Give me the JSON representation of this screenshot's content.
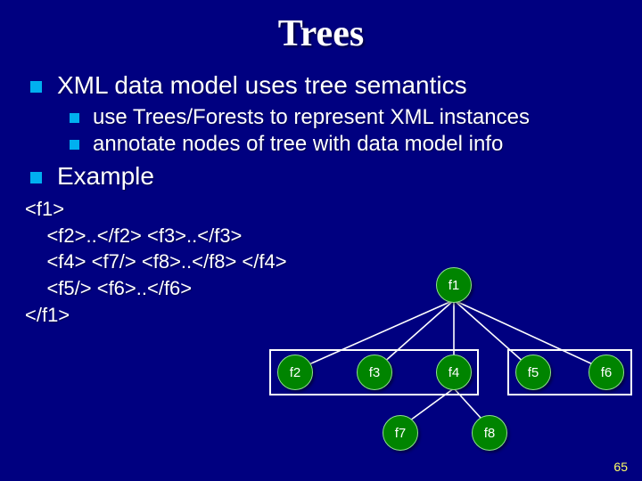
{
  "title": "Trees",
  "bullets": {
    "b1": "XML data model uses tree semantics",
    "b1a": "use Trees/Forests to represent XML instances",
    "b1b": "annotate nodes of tree with data model info",
    "b2": "Example"
  },
  "code": {
    "l1": "<f1>",
    "l2": "    <f2>..</f2> <f3>..</f3>",
    "l3": "    <f4> <f7/> <f8>..</f8> </f4>",
    "l4": "    <f5/> <f6>..</f6>",
    "l5": "</f1>"
  },
  "tree": {
    "nodes": {
      "f1": "f1",
      "f2": "f2",
      "f3": "f3",
      "f4": "f4",
      "f5": "f5",
      "f6": "f6",
      "f7": "f7",
      "f8": "f8"
    }
  },
  "pagenum": "65"
}
